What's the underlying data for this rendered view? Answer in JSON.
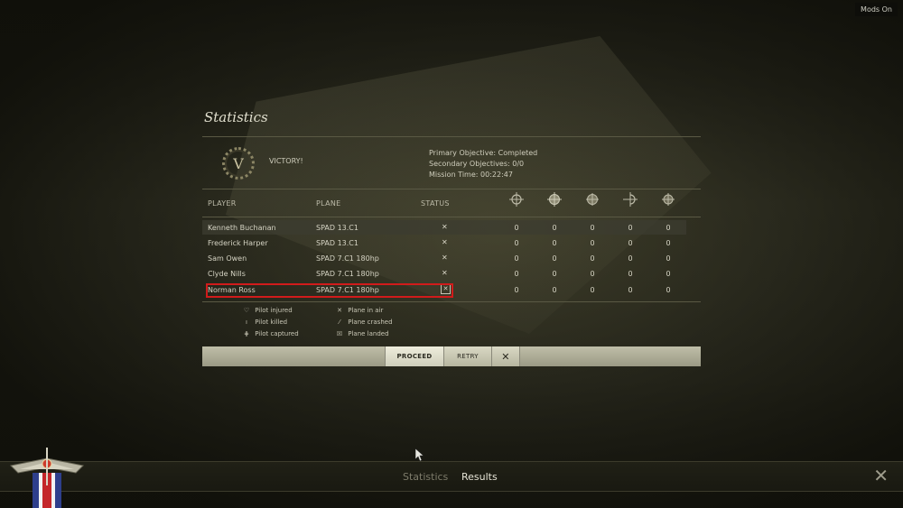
{
  "mods_badge": "Mods On",
  "panel": {
    "title": "Statistics",
    "emblem_letter": "V",
    "result": "VICTORY!",
    "objectives": [
      "Primary Objective: Completed",
      "Secondary Objectives: 0/0",
      "Mission Time: 00:22:47"
    ],
    "columns": {
      "player": "PLAYER",
      "plane": "PLANE",
      "status": "STATUS"
    },
    "stat_icons": [
      "aircraft-kills-icon",
      "balloon-kills-icon",
      "ground-targets-icon",
      "aircraft-assists-icon",
      "ground-assists-icon"
    ],
    "rows": [
      {
        "player": "Kenneth Buchanan",
        "plane": "SPAD 13.C1",
        "status": "plane-in-air",
        "status_glyph": "✕",
        "stats": [
          "0",
          "0",
          "0",
          "0",
          "0"
        ]
      },
      {
        "player": "Frederick Harper",
        "plane": "SPAD 13.C1",
        "status": "plane-in-air",
        "status_glyph": "✕",
        "stats": [
          "0",
          "0",
          "0",
          "0",
          "0"
        ]
      },
      {
        "player": "Sam Owen",
        "plane": "SPAD 7.C1 180hp",
        "status": "plane-in-air",
        "status_glyph": "✕",
        "stats": [
          "0",
          "0",
          "0",
          "0",
          "0"
        ]
      },
      {
        "player": "Clyde Nills",
        "plane": "SPAD 7.C1 180hp",
        "status": "plane-in-air",
        "status_glyph": "✕",
        "stats": [
          "0",
          "0",
          "0",
          "0",
          "0"
        ]
      },
      {
        "player": "Norman Ross",
        "plane": "SPAD 7.C1 180hp",
        "status": "plane-landed",
        "status_glyph": "✕",
        "stats": [
          "0",
          "0",
          "0",
          "0",
          "0"
        ]
      }
    ],
    "legend": {
      "pilot_injured": "Pilot injured",
      "pilot_killed": "Pilot killed",
      "pilot_captured": "Pilot captured",
      "plane_in_air": "Plane in air",
      "plane_crashed": "Plane crashed",
      "plane_landed": "Plane landed",
      "glyph_injured": "♡",
      "glyph_killed": "ı",
      "glyph_captured": "⋕",
      "glyph_in_air": "✕",
      "glyph_crashed": "⁄",
      "glyph_landed": "☒"
    },
    "buttons": {
      "proceed": "PROCEED",
      "retry": "RETRY",
      "close_glyph": "✕"
    }
  },
  "bottom_tabs": {
    "statistics": "Statistics",
    "results": "Results",
    "close_glyph": "✕"
  },
  "colors": {
    "selection_outline": "#d11b1b",
    "button_bar": "#bfbea8"
  }
}
